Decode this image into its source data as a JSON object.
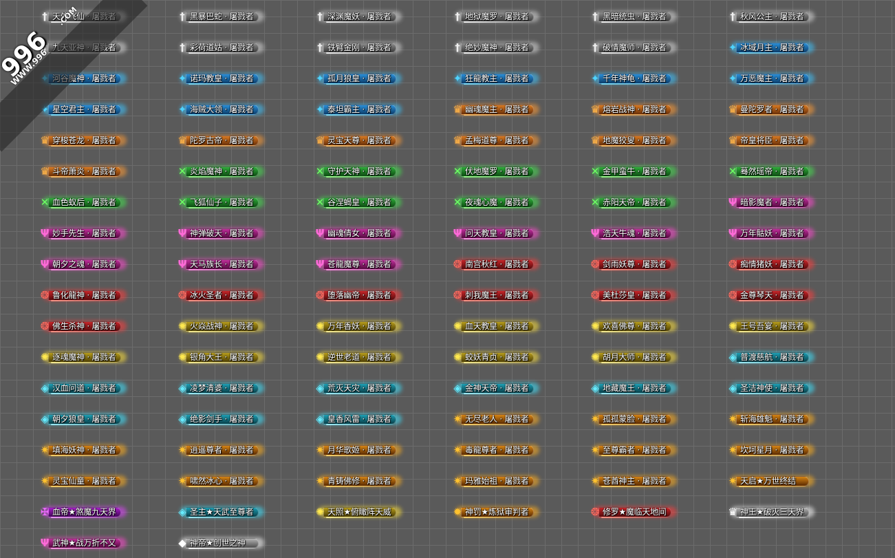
{
  "watermark": {
    "site_main": "996",
    "site_sub": "WWW.996",
    "site_tag": ".COM"
  },
  "rows": [
    [
      {
        "name": "天外飞仙",
        "title": "屠戮者",
        "tier": "silver",
        "icon": "sword-icon"
      },
      {
        "name": "黑暴巴蛇",
        "title": "屠戮者",
        "tier": "silver",
        "icon": "sword-icon"
      },
      {
        "name": "深渊魔妖",
        "title": "屠戮者",
        "tier": "silver",
        "icon": "sword-icon"
      },
      {
        "name": "地狱魔罗",
        "title": "屠戮者",
        "tier": "silver",
        "icon": "sword-icon"
      },
      {
        "name": "黑暗统虫",
        "title": "屠戮者",
        "tier": "silver",
        "icon": "sword-icon"
      },
      {
        "name": "秋风公主",
        "title": "屠戮者",
        "tier": "silver",
        "icon": "sword-icon"
      }
    ],
    [
      {
        "name": "九天亚神",
        "title": "屠戮者",
        "tier": "silver",
        "icon": "sword-icon"
      },
      {
        "name": "彩荷道姑",
        "title": "屠戮者",
        "tier": "silver",
        "icon": "sword-icon"
      },
      {
        "name": "铁臂金刚",
        "title": "屠戮者",
        "tier": "silver",
        "icon": "sword-icon"
      },
      {
        "name": "绝妙魔神",
        "title": "屠戮者",
        "tier": "silver",
        "icon": "sword-icon"
      },
      {
        "name": "破情魔师",
        "title": "屠戮者",
        "tier": "silver",
        "icon": "sword-icon"
      },
      {
        "name": "冰域月主",
        "title": "屠戮者",
        "tier": "blue",
        "icon": "wing-icon"
      }
    ],
    [
      {
        "name": "河谷魔神",
        "title": "屠戮者",
        "tier": "blue",
        "icon": "wing-icon"
      },
      {
        "name": "诺玛教皇",
        "title": "屠戮者",
        "tier": "blue",
        "icon": "wing-icon"
      },
      {
        "name": "孤月狼皇",
        "title": "屠戮者",
        "tier": "blue",
        "icon": "wing-icon"
      },
      {
        "name": "狂龍教主",
        "title": "屠戮者",
        "tier": "blue",
        "icon": "wing-icon"
      },
      {
        "name": "千年神龟",
        "title": "屠戮者",
        "tier": "blue",
        "icon": "wing-icon"
      },
      {
        "name": "万恶魔主",
        "title": "屠戮者",
        "tier": "blue",
        "icon": "wing-icon"
      }
    ],
    [
      {
        "name": "星空君主",
        "title": "屠戮者",
        "tier": "blue",
        "icon": "wing-icon"
      },
      {
        "name": "海贼大领",
        "title": "屠戮者",
        "tier": "blue",
        "icon": "wing-icon"
      },
      {
        "name": "泰坦霸主",
        "title": "屠戮者",
        "tier": "blue",
        "icon": "wing-icon"
      },
      {
        "name": "幽魂魔主",
        "title": "屠戮者",
        "tier": "orange",
        "icon": "crown-icon"
      },
      {
        "name": "熔岩战神",
        "title": "屠戮者",
        "tier": "orange",
        "icon": "crown-icon"
      },
      {
        "name": "曼陀罗者",
        "title": "屠戮者",
        "tier": "orange",
        "icon": "crown-icon"
      }
    ],
    [
      {
        "name": "穿梭苍龙",
        "title": "屠戮者",
        "tier": "orange",
        "icon": "crown-icon"
      },
      {
        "name": "陀罗古帝",
        "title": "屠戮者",
        "tier": "orange",
        "icon": "crown-icon"
      },
      {
        "name": "灵宝天尊",
        "title": "屠戮者",
        "tier": "orange",
        "icon": "crown-icon"
      },
      {
        "name": "孟梅道尊",
        "title": "屠戮者",
        "tier": "orange",
        "icon": "crown-icon"
      },
      {
        "name": "地魔狡叟",
        "title": "屠戮者",
        "tier": "orange",
        "icon": "crown-icon"
      },
      {
        "name": "帝皇将臣",
        "title": "屠戮者",
        "tier": "orange",
        "icon": "crown-icon"
      }
    ],
    [
      {
        "name": "斗帝萧炎",
        "title": "屠戮者",
        "tier": "orange",
        "icon": "crown-icon"
      },
      {
        "name": "炎焰魔神",
        "title": "屠戮者",
        "tier": "green",
        "icon": "cross-swords-icon"
      },
      {
        "name": "守护天神",
        "title": "屠戮者",
        "tier": "green",
        "icon": "cross-swords-icon"
      },
      {
        "name": "伏地魔罗",
        "title": "屠戮者",
        "tier": "green",
        "icon": "cross-swords-icon"
      },
      {
        "name": "金甲蛮牛",
        "title": "屠戮者",
        "tier": "green",
        "icon": "cross-swords-icon"
      },
      {
        "name": "蓦然瑶帝",
        "title": "屠戮者",
        "tier": "green",
        "icon": "cross-swords-icon"
      }
    ],
    [
      {
        "name": "血色蚁后",
        "title": "屠戮者",
        "tier": "green",
        "icon": "cross-swords-icon"
      },
      {
        "name": "飞狐仙子",
        "title": "屠戮者",
        "tier": "green",
        "icon": "cross-swords-icon"
      },
      {
        "name": "谷涅蝎皇",
        "title": "屠戮者",
        "tier": "green",
        "icon": "cross-swords-icon"
      },
      {
        "name": "夜魂心魔",
        "title": "屠戮者",
        "tier": "green",
        "icon": "cross-swords-icon"
      },
      {
        "name": "赤阳天帝",
        "title": "屠戮者",
        "tier": "green",
        "icon": "cross-swords-icon"
      },
      {
        "name": "暗影魔者",
        "title": "屠戮者",
        "tier": "pink",
        "icon": "trident-icon"
      }
    ],
    [
      {
        "name": "妙手先生",
        "title": "屠戮者",
        "tier": "pink",
        "icon": "trident-icon"
      },
      {
        "name": "神弹破天",
        "title": "屠戮者",
        "tier": "pink",
        "icon": "trident-icon"
      },
      {
        "name": "幽魂倩女",
        "title": "屠戮者",
        "tier": "pink",
        "icon": "trident-icon"
      },
      {
        "name": "问天教皇",
        "title": "屠戮者",
        "tier": "pink",
        "icon": "trident-icon"
      },
      {
        "name": "浩天牛魂",
        "title": "屠戮者",
        "tier": "pink",
        "icon": "trident-icon"
      },
      {
        "name": "万年骷妖",
        "title": "屠戮者",
        "tier": "pink",
        "icon": "trident-icon"
      }
    ],
    [
      {
        "name": "朝夕之魂",
        "title": "屠戮者",
        "tier": "pink",
        "icon": "trident-icon"
      },
      {
        "name": "天马族长",
        "title": "屠戮者",
        "tier": "pink",
        "icon": "trident-icon"
      },
      {
        "name": "苍龍魔尊",
        "title": "屠戮者",
        "tier": "pink",
        "icon": "trident-icon"
      },
      {
        "name": "南宫秋红",
        "title": "屠戮者",
        "tier": "red",
        "icon": "phoenix-icon"
      },
      {
        "name": "剑雨妖尊",
        "title": "屠戮者",
        "tier": "red",
        "icon": "phoenix-icon"
      },
      {
        "name": "痴情猪妖",
        "title": "屠戮者",
        "tier": "red",
        "icon": "phoenix-icon"
      }
    ],
    [
      {
        "name": "鲁化龍神",
        "title": "屠戮者",
        "tier": "red",
        "icon": "phoenix-icon"
      },
      {
        "name": "冰火圣者",
        "title": "屠戮者",
        "tier": "red",
        "icon": "phoenix-icon"
      },
      {
        "name": "堕落幽帝",
        "title": "屠戮者",
        "tier": "red",
        "icon": "phoenix-icon"
      },
      {
        "name": "刺我魔王",
        "title": "屠戮者",
        "tier": "red",
        "icon": "phoenix-icon"
      },
      {
        "name": "美杜莎皇",
        "title": "屠戮者",
        "tier": "red",
        "icon": "phoenix-icon"
      },
      {
        "name": "金尊琴天",
        "title": "屠戮者",
        "tier": "red",
        "icon": "phoenix-icon"
      }
    ],
    [
      {
        "name": "佛生杀神",
        "title": "屠戮者",
        "tier": "red",
        "icon": "phoenix-icon"
      },
      {
        "name": "火焱战神",
        "title": "屠戮者",
        "tier": "yellow",
        "icon": "lotus-icon"
      },
      {
        "name": "万年香妖",
        "title": "屠戮者",
        "tier": "yellow",
        "icon": "lotus-icon"
      },
      {
        "name": "血天教皇",
        "title": "屠戮者",
        "tier": "yellow",
        "icon": "lotus-icon"
      },
      {
        "name": "欢喜佛尊",
        "title": "屠戮者",
        "tier": "yellow",
        "icon": "lotus-icon"
      },
      {
        "name": "王号吾宴",
        "title": "屠戮者",
        "tier": "yellow",
        "icon": "lotus-icon"
      }
    ],
    [
      {
        "name": "逐魂魔神",
        "title": "屠戮者",
        "tier": "yellow",
        "icon": "lotus-icon"
      },
      {
        "name": "银角大王",
        "title": "屠戮者",
        "tier": "yellow",
        "icon": "lotus-icon"
      },
      {
        "name": "逆世老道",
        "title": "屠戮者",
        "tier": "yellow",
        "icon": "lotus-icon"
      },
      {
        "name": "蛟妖青贞",
        "title": "屠戮者",
        "tier": "yellow",
        "icon": "lotus-icon"
      },
      {
        "name": "胡月大师",
        "title": "屠戮者",
        "tier": "yellow",
        "icon": "lotus-icon"
      },
      {
        "name": "普渡慈航",
        "title": "屠戮者",
        "tier": "cyan",
        "icon": "gem-icon"
      }
    ],
    [
      {
        "name": "汉血问道",
        "title": "屠戮者",
        "tier": "cyan",
        "icon": "gem-icon"
      },
      {
        "name": "凌梦清婆",
        "title": "屠戮者",
        "tier": "cyan",
        "icon": "gem-icon"
      },
      {
        "name": "荒灭天灾",
        "title": "屠戮者",
        "tier": "cyan",
        "icon": "gem-icon"
      },
      {
        "name": "金神天帝",
        "title": "屠戮者",
        "tier": "cyan",
        "icon": "gem-icon"
      },
      {
        "name": "地藏魔王",
        "title": "屠戮者",
        "tier": "cyan",
        "icon": "gem-icon"
      },
      {
        "name": "圣洁神使",
        "title": "屠戮者",
        "tier": "cyan",
        "icon": "gem-icon"
      }
    ],
    [
      {
        "name": "朝夕狼皇",
        "title": "屠戮者",
        "tier": "cyan",
        "icon": "gem-icon"
      },
      {
        "name": "绝影剑手",
        "title": "屠戮者",
        "tier": "cyan",
        "icon": "gem-icon"
      },
      {
        "name": "皇香风雷",
        "title": "屠戮者",
        "tier": "cyan",
        "icon": "gem-icon"
      },
      {
        "name": "无尽老人",
        "title": "屠戮者",
        "tier": "gold",
        "icon": "flame-icon"
      },
      {
        "name": "孤孤蒙脸",
        "title": "屠戮者",
        "tier": "gold",
        "icon": "flame-icon"
      },
      {
        "name": "斩海雄魁",
        "title": "屠戮者",
        "tier": "gold",
        "icon": "flame-icon"
      }
    ],
    [
      {
        "name": "填海妖神",
        "title": "屠戮者",
        "tier": "gold",
        "icon": "flame-icon"
      },
      {
        "name": "逍遥尊者",
        "title": "屠戮者",
        "tier": "gold",
        "icon": "flame-icon"
      },
      {
        "name": "月华歌姬",
        "title": "屠戮者",
        "tier": "gold",
        "icon": "flame-icon"
      },
      {
        "name": "毒龍尊者",
        "title": "屠戮者",
        "tier": "gold",
        "icon": "flame-icon"
      },
      {
        "name": "至尊霸者",
        "title": "屠戮者",
        "tier": "gold",
        "icon": "flame-icon"
      },
      {
        "name": "坎坷星月",
        "title": "屠戮者",
        "tier": "gold",
        "icon": "flame-icon"
      }
    ],
    [
      {
        "name": "灵宝仙童",
        "title": "屠戮者",
        "tier": "gold",
        "icon": "flame-icon"
      },
      {
        "name": "啸然冰心",
        "title": "屠戮者",
        "tier": "gold",
        "icon": "flame-icon"
      },
      {
        "name": "青铸佛修",
        "title": "屠戮者",
        "tier": "gold",
        "icon": "flame-icon"
      },
      {
        "name": "玛雅始祖",
        "title": "屠戮者",
        "tier": "gold",
        "icon": "flame-icon"
      },
      {
        "name": "苍酋神主",
        "title": "屠戮者",
        "tier": "gold",
        "icon": "flame-icon"
      },
      {
        "name": "天启★万世终结",
        "title": "",
        "tier": "gold",
        "icon": "flame-icon"
      }
    ],
    [
      {
        "name": "血帝★煞魔九天界",
        "title": "",
        "tier": "magenta",
        "icon": "demon-icon"
      },
      {
        "name": "圣主★天武至尊者",
        "title": "",
        "tier": "cyan",
        "icon": "gem-icon"
      },
      {
        "name": "天照★俯瞰阵天威",
        "title": "",
        "tier": "yellow",
        "icon": "lotus-icon"
      },
      {
        "name": "神罚★炼狱审判者",
        "title": "",
        "tier": "gold",
        "icon": "dragon-icon"
      },
      {
        "name": "修罗★魔临天地间",
        "title": "",
        "tier": "red",
        "icon": "phoenix-icon"
      },
      {
        "name": "神王★破灭三天界",
        "title": "",
        "tier": "white",
        "icon": "crown-icon"
      }
    ],
    [
      {
        "name": "武神★战万折不又",
        "title": "",
        "tier": "pink",
        "icon": "trident-icon"
      },
      {
        "name": "神帝★创世之神",
        "title": "",
        "tier": "white",
        "icon": "diamond-icon"
      }
    ]
  ]
}
